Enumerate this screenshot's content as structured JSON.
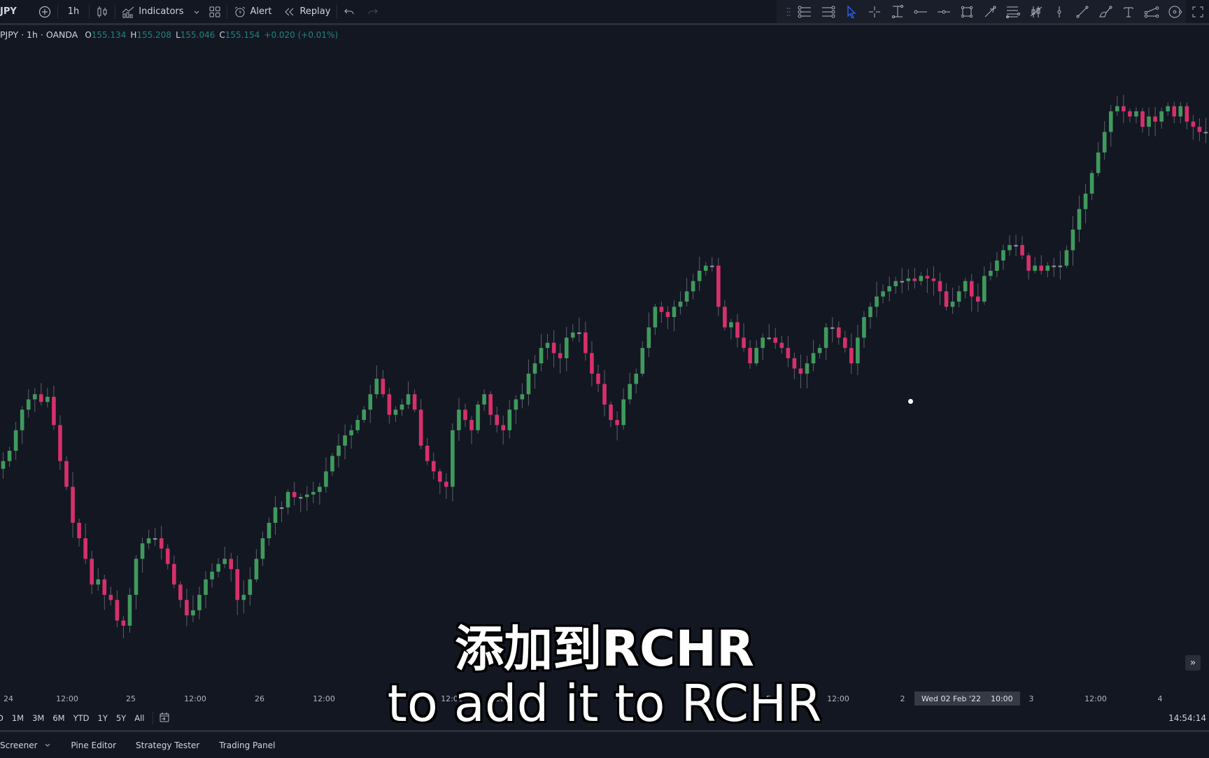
{
  "toolbar": {
    "symbol": "JPY",
    "add_symbol_icon": "plus-circle-icon",
    "interval": "1h",
    "chart_type_icon": "candles-icon",
    "indicators_label": "Indicators",
    "layouts_icon": "grid-icon",
    "alert_label": "Alert",
    "replay_label": "Replay",
    "undo_icon": "undo-icon",
    "redo_icon": "redo-icon"
  },
  "drawing_tools": [
    "drag-handle-icon",
    "long-position-icon",
    "short-position-icon",
    "cursor-icon",
    "crosshair-icon",
    "price-range-icon",
    "horizontal-ray-icon",
    "horizontal-line-icon",
    "rectangle-icon",
    "arrow-icon",
    "parallel-channel-icon",
    "bars-pattern-icon",
    "vertical-line-icon",
    "trend-line-icon",
    "brush-icon",
    "text-icon",
    "path-icon",
    "circle-icon",
    "fullscreen-icon"
  ],
  "legend": {
    "title": "PJPY · 1h · OANDA",
    "open_key": "O",
    "open": "155.134",
    "high_key": "H",
    "high": "155.208",
    "low_key": "L",
    "low": "155.046",
    "close_key": "C",
    "close": "155.154",
    "change": "+0.020 (+0.01%)"
  },
  "colors": {
    "up": "#26a69a",
    "down": "#e91e63",
    "background": "#131722",
    "wick": "#5d606b"
  },
  "time_axis": {
    "labels": [
      "24",
      "12:00",
      "25",
      "12:00",
      "26",
      "12:00",
      "12:00",
      "28",
      "Fr",
      "12:00",
      "2",
      "3",
      "12:00",
      "4"
    ],
    "crosshair_label_date": "Wed 02 Feb '22",
    "crosshair_label_time": "10:00"
  },
  "range_buttons": [
    "D",
    "1M",
    "3M",
    "6M",
    "YTD",
    "1Y",
    "5Y",
    "All"
  ],
  "clock": "14:54:14",
  "bottom_panel": {
    "tabs": [
      "Screener",
      "Pine Editor",
      "Strategy Tester",
      "Trading Panel"
    ]
  },
  "subtitle": {
    "line1": "添加到RCHR",
    "line2": "to add it to RCHR"
  },
  "chart_data": {
    "type": "candlestick",
    "title": "PJPY · 1h · OANDA",
    "xlabel": "",
    "ylabel": "",
    "grid": false,
    "closes": [
      154.1,
      154.14,
      154.22,
      154.3,
      154.34,
      154.36,
      154.33,
      154.35,
      154.24,
      154.1,
      154.0,
      153.86,
      153.8,
      153.72,
      153.62,
      153.64,
      153.58,
      153.56,
      153.48,
      153.46,
      153.58,
      153.72,
      153.78,
      153.8,
      153.8,
      153.76,
      153.7,
      153.62,
      153.56,
      153.5,
      153.52,
      153.58,
      153.64,
      153.67,
      153.7,
      153.72,
      153.68,
      153.56,
      153.58,
      153.64,
      153.72,
      153.8,
      153.86,
      153.92,
      153.92,
      153.98,
      153.96,
      153.96,
      153.97,
      153.98,
      154.0,
      154.06,
      154.12,
      154.16,
      154.2,
      154.22,
      154.26,
      154.3,
      154.36,
      154.42,
      154.36,
      154.28,
      154.3,
      154.32,
      154.36,
      154.3,
      154.16,
      154.1,
      154.06,
      154.02,
      154.0,
      154.22,
      154.3,
      154.26,
      154.22,
      154.32,
      154.36,
      154.28,
      154.24,
      154.22,
      154.3,
      154.34,
      154.36,
      154.44,
      154.48,
      154.54,
      154.56,
      154.52,
      154.5,
      154.58,
      154.6,
      154.6,
      154.52,
      154.44,
      154.4,
      154.32,
      154.26,
      154.24,
      154.34,
      154.4,
      154.44,
      154.54,
      154.62,
      154.7,
      154.68,
      154.66,
      154.7,
      154.72,
      154.76,
      154.8,
      154.84,
      154.86,
      154.86,
      154.7,
      154.62,
      154.64,
      154.58,
      154.54,
      154.48,
      154.54,
      154.58,
      154.58,
      154.56,
      154.54,
      154.5,
      154.46,
      154.44,
      154.48,
      154.52,
      154.54,
      154.62,
      154.62,
      154.58,
      154.54,
      154.48,
      154.58,
      154.66,
      154.7,
      154.74,
      154.76,
      154.78,
      154.8,
      154.8,
      154.81,
      154.8,
      154.82,
      154.81,
      154.8,
      154.76,
      154.7,
      154.72,
      154.76,
      154.8,
      154.74,
      154.72,
      154.82,
      154.84,
      154.88,
      154.92,
      154.94,
      154.94,
      154.9,
      154.84,
      154.86,
      154.84,
      154.86,
      154.86,
      154.86,
      154.92,
      155.0,
      155.08,
      155.14,
      155.22,
      155.3,
      155.38,
      155.46,
      155.48,
      155.46,
      155.44,
      155.46,
      155.4,
      155.44,
      155.42,
      155.46,
      155.48,
      155.44,
      155.48,
      155.42,
      155.4,
      155.38,
      155.38
    ],
    "price_range": [
      153.4,
      155.55
    ]
  }
}
